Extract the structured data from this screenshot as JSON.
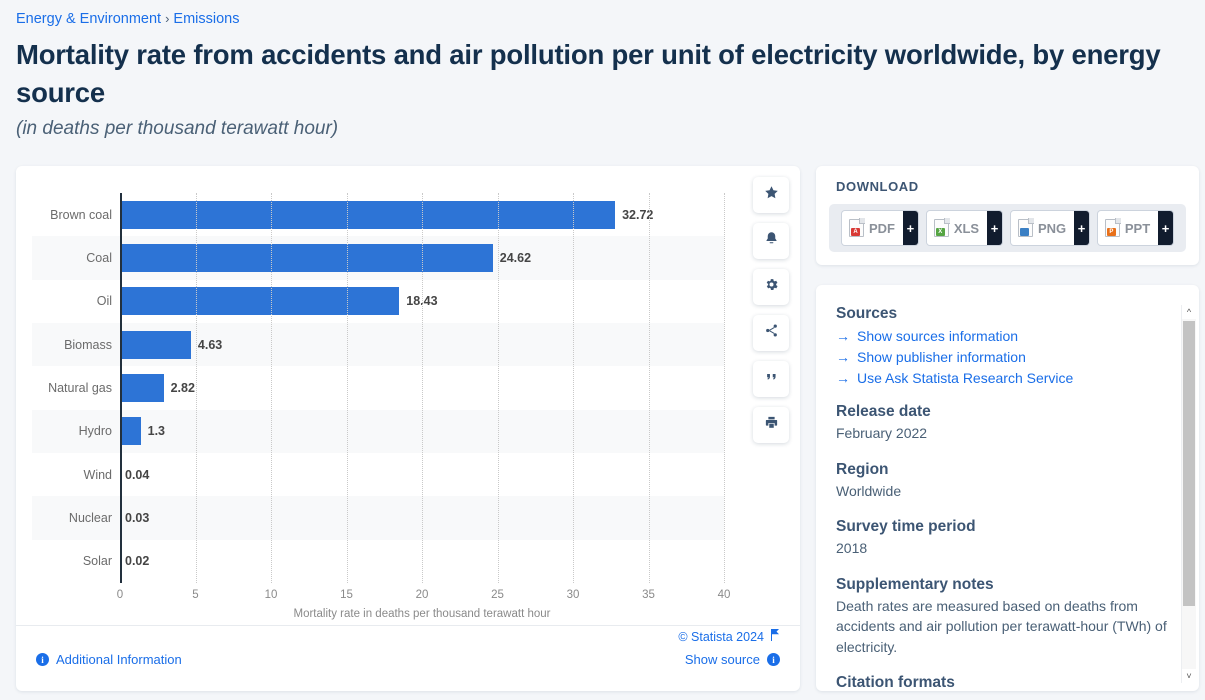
{
  "breadcrumb": {
    "root": "Energy & Environment",
    "separator": "›",
    "current": "Emissions"
  },
  "header": {
    "title": "Mortality rate from accidents and air pollution per unit of electricity worldwide, by energy source",
    "subtitle": "(in deaths per thousand terawatt hour)"
  },
  "action_rail": [
    {
      "name": "favorite",
      "icon": "star-icon"
    },
    {
      "name": "alert",
      "icon": "bell-icon"
    },
    {
      "name": "settings",
      "icon": "gear-icon"
    },
    {
      "name": "share",
      "icon": "share-icon"
    },
    {
      "name": "cite",
      "icon": "quote-icon"
    },
    {
      "name": "print",
      "icon": "print-icon"
    }
  ],
  "chart_data": {
    "type": "bar",
    "orientation": "horizontal",
    "title": "Mortality rate from accidents and air pollution per unit of electricity worldwide, by energy source",
    "subtitle": "(in deaths per thousand terawatt hour)",
    "categories": [
      "Brown coal",
      "Coal",
      "Oil",
      "Biomass",
      "Natural gas",
      "Hydro",
      "Wind",
      "Nuclear",
      "Solar"
    ],
    "values": [
      32.72,
      24.62,
      18.43,
      4.63,
      2.82,
      1.3,
      0.04,
      0.03,
      0.02
    ],
    "value_labels": [
      "32.72",
      "24.62",
      "18.43",
      "4.63",
      "2.82",
      "1.3",
      "0.04",
      "0.03",
      "0.02"
    ],
    "xlabel": "Mortality rate in deaths per thousand terawatt hour",
    "ylabel": "",
    "xlim": [
      0,
      40
    ],
    "xticks": [
      0,
      5,
      10,
      15,
      20,
      25,
      30,
      35,
      40
    ],
    "xtick_labels": [
      "0",
      "5",
      "10",
      "15",
      "20",
      "25",
      "30",
      "35",
      "40"
    ],
    "grid": "vertical-dotted",
    "legend": "none",
    "bar_color": "#2d74d6"
  },
  "chart_footer": {
    "additional_information": "Additional Information",
    "copyright": "© Statista 2024",
    "show_source": "Show source"
  },
  "download": {
    "title": "DOWNLOAD",
    "buttons": [
      {
        "label": "PDF",
        "plus": "+",
        "badge": "A",
        "badge_color": "#d83a36"
      },
      {
        "label": "XLS",
        "plus": "+",
        "badge": "X",
        "badge_color": "#56a544"
      },
      {
        "label": "PNG",
        "plus": "+",
        "badge": "",
        "badge_color": "#3a7fc4"
      },
      {
        "label": "PPT",
        "plus": "+",
        "badge": "P",
        "badge_color": "#e8701a"
      }
    ]
  },
  "sources": {
    "heading": "Sources",
    "links": [
      "Show sources information",
      "Show publisher information",
      "Use Ask Statista Research Service"
    ],
    "blocks": [
      {
        "heading": "Release date",
        "value": "February 2022"
      },
      {
        "heading": "Region",
        "value": "Worldwide"
      },
      {
        "heading": "Survey time period",
        "value": "2018"
      },
      {
        "heading": "Supplementary notes",
        "value": "Death rates are measured based on deaths from accidents and air pollution per terawatt-hour (TWh) of electricity."
      }
    ],
    "next_heading": "Citation formats"
  }
}
